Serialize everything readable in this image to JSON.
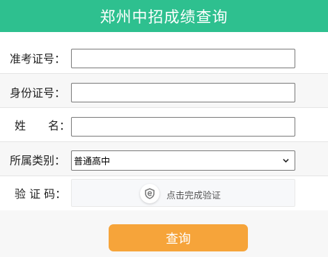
{
  "header": {
    "title": "郑州中招成绩查询"
  },
  "form": {
    "exam_number": {
      "label": "准考证号：",
      "value": ""
    },
    "id_number": {
      "label": "身份证号：",
      "value": ""
    },
    "name": {
      "label_first": "姓",
      "label_second": "名：",
      "value": ""
    },
    "category": {
      "label": "所属类别：",
      "selected": "普通高中"
    },
    "captcha": {
      "label": "验 证 码：",
      "prompt": "点击完成验证",
      "icon": "captcha-shield-icon"
    }
  },
  "submit": {
    "label": "查询"
  },
  "colors": {
    "header_bg": "#2ec08f",
    "button_bg": "#f6a43a",
    "row_alt_bg": "#f7f7f7"
  }
}
